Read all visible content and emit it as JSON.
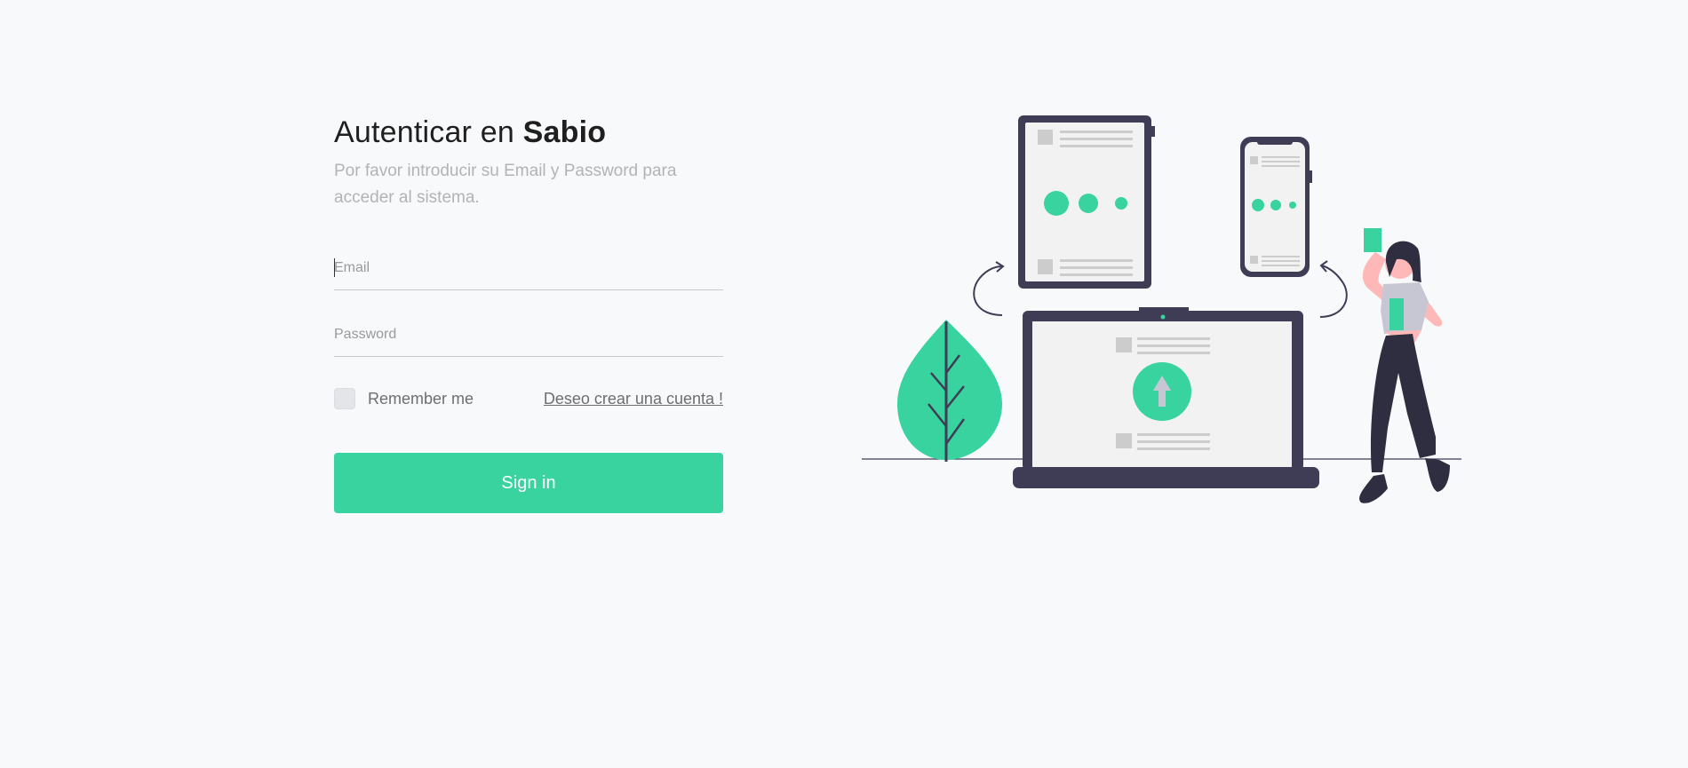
{
  "login": {
    "title_prefix": "Autenticar en",
    "title_brand": "Sabio",
    "subtitle": "Por favor introducir su Email y Password para acceder al sistema.",
    "email_placeholder": "Email",
    "email_value": "",
    "password_placeholder": "Password",
    "password_value": "",
    "remember_label": "Remember me",
    "remember_checked": false,
    "create_account_link": "Deseo crear una cuenta !",
    "signin_label": "Sign in"
  },
  "theme": {
    "accent": "#38d39f",
    "dark": "#3f3d56",
    "background": "#f8f9fb"
  },
  "illustration": {
    "icons": [
      "tablet-icon",
      "phone-icon",
      "laptop-icon",
      "upload-arrow-icon",
      "leaf-icon",
      "person-icon",
      "refresh-arrow-icon"
    ]
  }
}
